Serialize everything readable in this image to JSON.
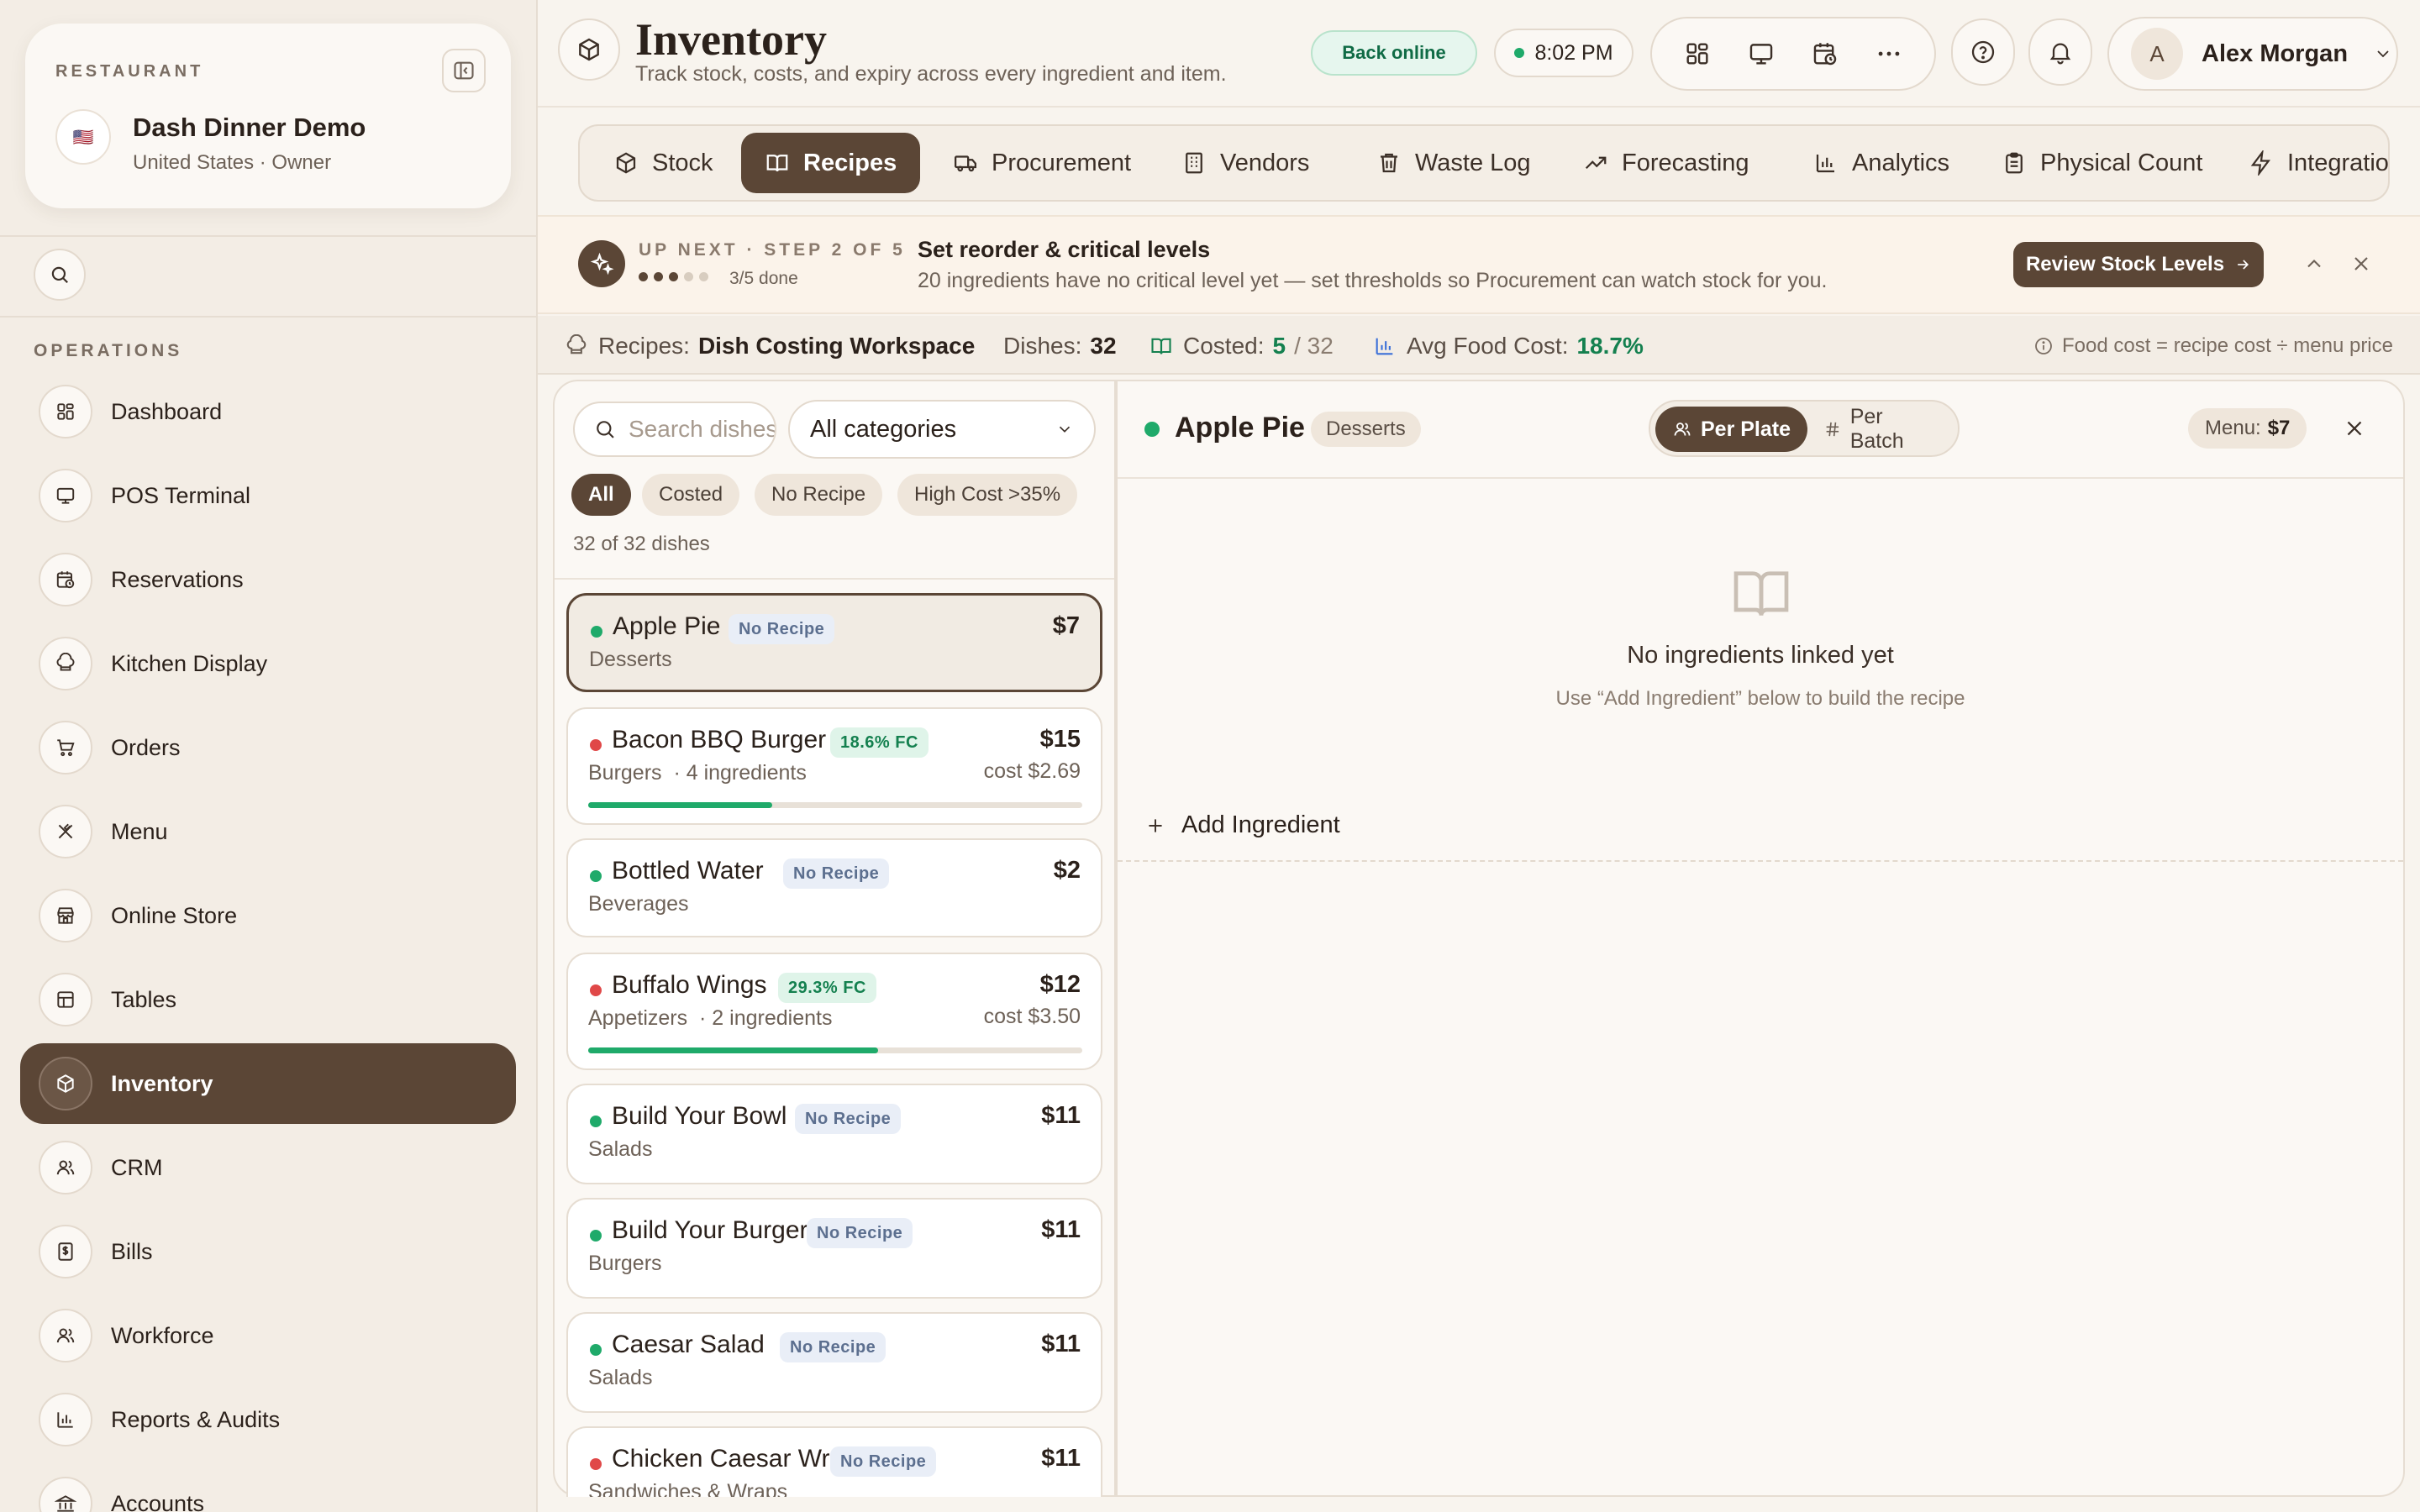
{
  "restaurant": {
    "label": "RESTAURANT",
    "name": "Dash Dinner Demo",
    "subtitle": "United States · Owner",
    "flag": "🇺🇸"
  },
  "sidebar": {
    "section_label": "OPERATIONS",
    "items": [
      {
        "label": "Dashboard",
        "icon": "dashboard-icon"
      },
      {
        "label": "POS Terminal",
        "icon": "monitor-icon"
      },
      {
        "label": "Reservations",
        "icon": "calendar-clock-icon"
      },
      {
        "label": "Kitchen Display",
        "icon": "chef-hat-icon"
      },
      {
        "label": "Orders",
        "icon": "cart-icon"
      },
      {
        "label": "Menu",
        "icon": "utensils-icon"
      },
      {
        "label": "Online Store",
        "icon": "store-icon"
      },
      {
        "label": "Tables",
        "icon": "table-icon"
      },
      {
        "label": "Inventory",
        "icon": "box-icon",
        "active": true
      },
      {
        "label": "CRM",
        "icon": "users-icon"
      },
      {
        "label": "Bills",
        "icon": "receipt-icon"
      },
      {
        "label": "Workforce",
        "icon": "team-icon"
      },
      {
        "label": "Reports & Audits",
        "icon": "bar-chart-icon"
      },
      {
        "label": "Accounts",
        "icon": "bank-icon"
      }
    ]
  },
  "header": {
    "title": "Inventory",
    "subtitle": "Track stock, costs, and expiry across every ingredient and item.",
    "status": "Back online",
    "time": "8:02 PM",
    "user_initial": "A",
    "user_name": "Alex Morgan"
  },
  "tabs": [
    {
      "label": "Stock",
      "icon": "box-icon"
    },
    {
      "label": "Recipes",
      "icon": "book-icon",
      "active": true
    },
    {
      "label": "Procurement",
      "icon": "truck-icon"
    },
    {
      "label": "Vendors",
      "icon": "building-icon"
    },
    {
      "label": "Waste Log",
      "icon": "trash-icon"
    },
    {
      "label": "Forecasting",
      "icon": "trend-icon"
    },
    {
      "label": "Analytics",
      "icon": "bar-chart-icon"
    },
    {
      "label": "Physical Count",
      "icon": "clipboard-icon"
    },
    {
      "label": "Integrations",
      "icon": "bolt-icon"
    }
  ],
  "banner": {
    "step": "UP NEXT · STEP 2 OF 5",
    "progress": "3/5 done",
    "steps_done": 3,
    "steps_total": 5,
    "title": "Set reorder & critical levels",
    "description": "20 ingredients have no critical level yet — set thresholds so Procurement can watch stock for you.",
    "button": "Review Stock Levels"
  },
  "summary": {
    "recipes_label": "Recipes:",
    "recipes_value": "Dish Costing Workspace",
    "dishes_label": "Dishes:",
    "dishes_value": "32",
    "costed_label": "Costed:",
    "costed_value": "5",
    "costed_total": "/ 32",
    "avg_label": "Avg Food Cost:",
    "avg_value": "18.7%",
    "note": "Food cost = recipe cost ÷ menu price"
  },
  "dish_list": {
    "search_placeholder": "Search dishes",
    "category": "All categories",
    "filters": [
      "All",
      "Costed",
      "No Recipe",
      "High Cost >35%"
    ],
    "count": "32 of 32 dishes",
    "dishes": [
      {
        "name": "Apple Pie",
        "badge": "No Recipe",
        "price": "$7",
        "category": "Desserts",
        "status": "green",
        "selected": true
      },
      {
        "name": "Bacon BBQ Burger",
        "badge": "18.6% FC",
        "price": "$15",
        "category": "Burgers",
        "ingredients": "· 4 ingredients",
        "cost": "cost $2.69",
        "status": "red",
        "fc_fraction": 0.186
      },
      {
        "name": "Bottled Water",
        "badge": "No Recipe",
        "price": "$2",
        "category": "Beverages",
        "status": "green"
      },
      {
        "name": "Buffalo Wings",
        "badge": "29.3% FC",
        "price": "$12",
        "category": "Appetizers",
        "ingredients": "· 2 ingredients",
        "cost": "cost $3.50",
        "status": "red",
        "fc_fraction": 0.293
      },
      {
        "name": "Build Your Bowl",
        "badge": "No Recipe",
        "price": "$11",
        "category": "Salads",
        "status": "green"
      },
      {
        "name": "Build Your Burger",
        "badge": "No Recipe",
        "price": "$11",
        "category": "Burgers",
        "status": "green"
      },
      {
        "name": "Caesar Salad",
        "badge": "No Recipe",
        "price": "$11",
        "category": "Salads",
        "status": "green"
      },
      {
        "name": "Chicken Caesar Wrap",
        "badge": "No Recipe",
        "price": "$11",
        "category": "Sandwiches & Wraps",
        "status": "red"
      }
    ]
  },
  "detail": {
    "name": "Apple Pie",
    "category": "Desserts",
    "per_plate": "Per Plate",
    "per_batch": "Per Batch",
    "menu_label": "Menu:",
    "menu_value": "$7",
    "empty_title": "No ingredients linked yet",
    "empty_sub": "Use “Add Ingredient” below to build the recipe",
    "add_button": "Add Ingredient"
  },
  "colors": {
    "accent": "#5b4636",
    "green": "#1faa6a",
    "red": "#e04848",
    "background": "#f8f4ee"
  }
}
